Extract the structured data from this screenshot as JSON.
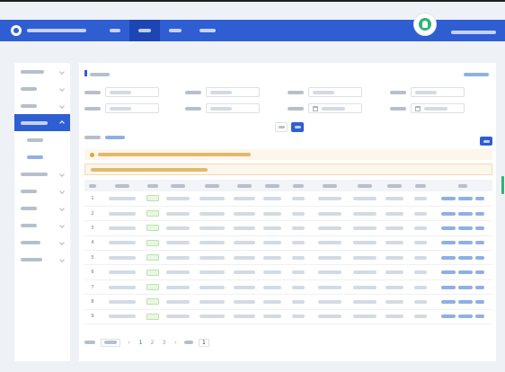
{
  "header": {
    "nav_items": [
      {},
      {},
      {},
      {}
    ],
    "active_nav": 1
  },
  "sidebar": {
    "items": [
      {
        "level": 1,
        "expandable": true
      },
      {
        "level": 1,
        "expandable": true
      },
      {
        "level": 1,
        "expandable": true
      },
      {
        "level": 1,
        "expandable": true,
        "selected": true
      },
      {
        "level": 2
      },
      {
        "level": 2
      },
      {
        "level": 1,
        "expandable": true
      },
      {
        "level": 1,
        "expandable": true
      },
      {
        "level": 1,
        "expandable": true
      },
      {
        "level": 1,
        "expandable": true
      },
      {
        "level": 1,
        "expandable": true
      },
      {
        "level": 1,
        "expandable": true
      }
    ]
  },
  "filters": {
    "row1": [
      {},
      {},
      {},
      {}
    ],
    "row2": [
      {},
      {},
      {},
      {}
    ]
  },
  "table": {
    "columns": [
      {},
      {},
      {},
      {},
      {},
      {},
      {},
      {},
      {},
      {},
      {},
      {},
      {}
    ],
    "row_numbers": [
      "1",
      "2",
      "3",
      "4",
      "5",
      "6",
      "7",
      "8",
      "9"
    ]
  },
  "pagination": {
    "pages": [
      "1",
      "2",
      "3"
    ],
    "current_page": "1",
    "jump_value": "1"
  },
  "colors": {
    "brand_blue": "#2f5ed3",
    "success_green": "#2bb673",
    "warning_amber": "#e6a23c"
  },
  "icons": [
    "logo-icon",
    "avatar-icon",
    "chevron-down-icon",
    "calendar-icon",
    "warning-icon"
  ]
}
